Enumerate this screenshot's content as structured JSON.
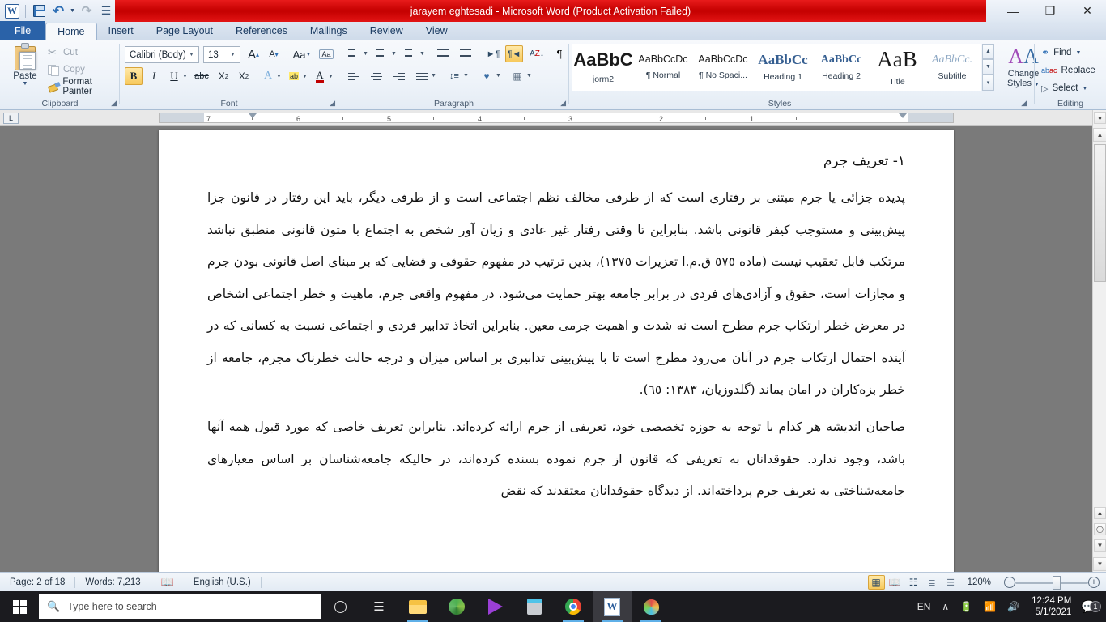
{
  "titlebar": {
    "doc_title": "jarayem eghtesadi  -  Microsoft Word (Product Activation Failed)",
    "accent_red": "#d40000",
    "qat": [
      {
        "name": "word-logo",
        "label": "W"
      },
      {
        "name": "save",
        "label": "Save"
      },
      {
        "name": "undo",
        "label": "Undo"
      },
      {
        "name": "redo",
        "label": "Redo"
      },
      {
        "name": "quick-print",
        "label": "Quick Print"
      },
      {
        "name": "customize",
        "label": "Customize Quick Access Toolbar"
      }
    ],
    "window_controls": {
      "minimize": "—",
      "restore": "❐",
      "close": "✕"
    }
  },
  "tabs": [
    {
      "label": "File",
      "id": "file"
    },
    {
      "label": "Home",
      "id": "home"
    },
    {
      "label": "Insert",
      "id": "insert"
    },
    {
      "label": "Page Layout",
      "id": "page-layout"
    },
    {
      "label": "References",
      "id": "references"
    },
    {
      "label": "Mailings",
      "id": "mailings"
    },
    {
      "label": "Review",
      "id": "review"
    },
    {
      "label": "View",
      "id": "view"
    }
  ],
  "active_tab": "Home",
  "ribbon": {
    "clipboard": {
      "label": "Clipboard",
      "paste": "Paste",
      "cut": "Cut",
      "copy": "Copy",
      "format_painter": "Format Painter"
    },
    "font": {
      "label": "Font",
      "font_name": "Calibri (Body)",
      "font_size": "13",
      "grow_font": "A",
      "shrink_font": "A",
      "change_case": "Aa",
      "clear_formatting": "Aa",
      "bold": "B",
      "italic": "I",
      "underline": "U",
      "strikethrough": "abc",
      "subscript": "X",
      "superscript": "X",
      "text_effects": "A",
      "highlight": "ab",
      "font_color": "A"
    },
    "paragraph": {
      "label": "Paragraph",
      "bullets": "Bullets",
      "numbering": "Numbering",
      "multilevel": "Multilevel List",
      "decrease_indent": "Decrease Indent",
      "increase_indent": "Increase Indent",
      "ltr": "Left-to-Right Text Direction",
      "rtl": "Right-to-Left Text Direction",
      "sort": "Sort",
      "show_marks": "¶",
      "align_left": "Align Left",
      "center": "Center",
      "align_right": "Align Right",
      "justify": "Justify",
      "line_spacing": "Line and Paragraph Spacing",
      "shading": "Shading",
      "borders": "Borders"
    },
    "styles": {
      "label": "Styles",
      "change_styles": "Change\nStyles",
      "change_styles_l1": "Change",
      "change_styles_l2": "Styles",
      "items": [
        {
          "preview": "AaBbC",
          "name": "jorm2"
        },
        {
          "preview": "AaBbCcDc",
          "name": "¶ Normal"
        },
        {
          "preview": "AaBbCcDc",
          "name": "¶ No Spaci..."
        },
        {
          "preview": "AaBbCc",
          "name": "Heading 1"
        },
        {
          "preview": "AaBbCc",
          "name": "Heading 2"
        },
        {
          "preview": "AaB",
          "name": "Title"
        },
        {
          "preview": "AaBbCc.",
          "name": "Subtitle"
        }
      ]
    },
    "editing": {
      "label": "Editing",
      "find": "Find",
      "replace": "Replace",
      "select": "Select"
    }
  },
  "ruler": {
    "numbers": [
      "7",
      "6",
      "5",
      "4",
      "3",
      "2",
      "1"
    ],
    "corner_label": "L"
  },
  "document": {
    "heading": "١- تعریف جرم",
    "paragraphs": [
      "پدیده جزائی یا جرم مبتنی بر رفتاری است که از طرفی مخالف نظم اجتماعی است و از طرفی دیگر، باید این رفتار در قانون جزا پیش‌بینی و مستوجب کیفر قانونی باشد. بنابراین تا وقتی رفتار غیر عادی و زیان آور شخص به اجتماع با متون قانونی منطبق نباشد مرتکب قابل تعقیب نیست (ماده ٥٧٥ ق.م.ا تعزیرات ١٣٧٥)، بدین ترتیب در مفهوم حقوقی و قضایی که بر مبنای اصل قانونی بودن جرم و مجازات است، حقوق و آزادی‌های فردی در برابر جامعه بهتر حمایت می‌شود. در مفهوم واقعی جرم، ماهیت و خطر اجتماعی اشخاص در معرض خطر ارتکاب جرم مطرح است نه شدت و اهمیت جرمی معین. بنابراین اتخاذ تدابیر فردی و اجتماعی نسبت به کسانی که در آینده احتمال ارتکاب جرم در آنان می‌رود مطرح است تا با پیش‌بینی تدابیری بر اساس میزان و درجه حالت خطرناک مجرم، جامعه از خطر بزه‌کاران در امان بماند (گلدوزیان، ١٣٨٣: ٦٥).",
      "صاحبان اندیشه هر کدام با توجه به حوزه تخصصی خود، تعریفی از جرم ارائه کرده‌اند. بنابراین تعریف خاصی که مورد قبول همه آنها باشد، وجود ندارد. حقوقدانان به تعریفی که قانون از جرم نموده بسنده کرده‌اند، در حالیکه جامعه‌شناسان بر اساس معیارهای جامعه‌شناختی به تعریف جرم پرداخته‌اند. از دیدگاه حقوقدانان معتقدند که نقض"
    ]
  },
  "statusbar": {
    "page": "Page: 2 of 18",
    "words": "Words: 7,213",
    "language": "English (U.S.)",
    "proofing_icon": "proofing-errors-icon",
    "zoom_level": "120%",
    "views": [
      {
        "name": "print-layout",
        "active": true
      },
      {
        "name": "full-screen-reading",
        "active": false
      },
      {
        "name": "web-layout",
        "active": false
      },
      {
        "name": "outline",
        "active": false
      },
      {
        "name": "draft",
        "active": false
      }
    ],
    "zoom_out": "−",
    "zoom_in": "+"
  },
  "taskbar": {
    "search_placeholder": "Type here to search",
    "apps": [
      {
        "name": "cortana",
        "label": "Cortana"
      },
      {
        "name": "task-view",
        "label": "Task View"
      },
      {
        "name": "file-explorer",
        "label": "File Explorer"
      },
      {
        "name": "internet-download-manager",
        "label": "Internet Download Manager"
      },
      {
        "name": "movies-tv",
        "label": "Movies & TV"
      },
      {
        "name": "calculator",
        "label": "Calculator"
      },
      {
        "name": "google-chrome",
        "label": "Google Chrome"
      },
      {
        "name": "microsoft-word",
        "label": "Microsoft Word"
      },
      {
        "name": "paint",
        "label": "Paint"
      }
    ],
    "tray": {
      "language": "EN",
      "show_hidden": "∧",
      "battery": "battery-icon",
      "wifi": "wifi-icon",
      "volume": "volume-icon",
      "time": "12:24 PM",
      "date": "5/1/2021",
      "notification_count": "1"
    }
  }
}
